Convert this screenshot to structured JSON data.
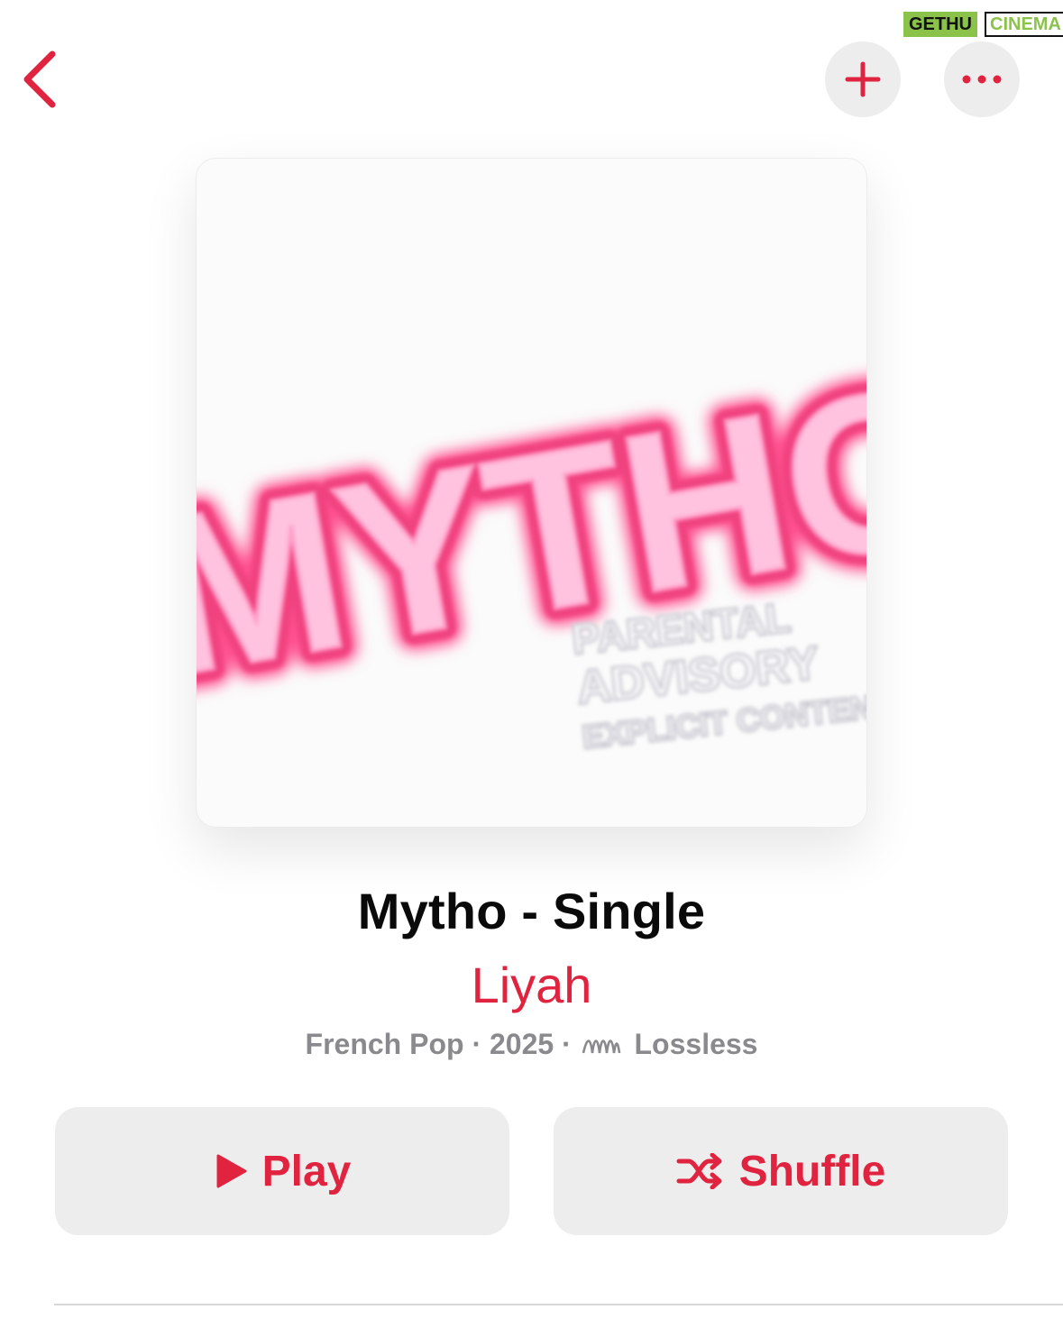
{
  "watermark": {
    "left_text": "GETHU",
    "right_text": "CINEMA"
  },
  "header": {
    "back_icon": "chevron-left-icon",
    "add_icon": "plus-icon",
    "more_icon": "ellipsis-icon"
  },
  "artwork": {
    "title_text": "MYTHO",
    "advisory_lines": [
      "PARENTAL",
      "ADVISORY",
      "EXPLICIT CONTENT"
    ]
  },
  "album": {
    "title": "Mytho - Single",
    "artist": "Liyah",
    "genre": "French Pop",
    "separator": "·",
    "year": "2025",
    "quality": "Lossless"
  },
  "actions": {
    "play_label": "Play",
    "shuffle_label": "Shuffle"
  },
  "colors": {
    "accent": "#e0243f",
    "button_bg": "#ededee",
    "secondary_text": "#8a8a8e"
  }
}
